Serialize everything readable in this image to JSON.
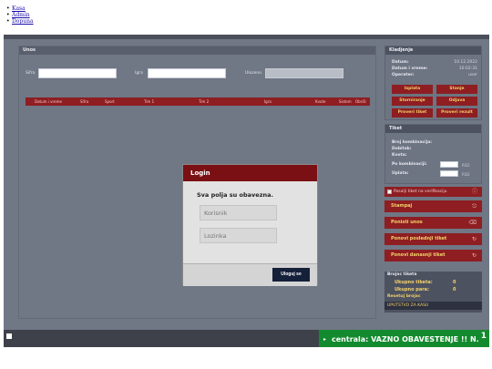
{
  "nav_links": [
    "Kasa",
    "Admin",
    "Dopuna"
  ],
  "unos": {
    "title": "Unos",
    "sifra_label": "Sifra",
    "igra_label": "Igra",
    "ulozeno_label": "Ulozeno",
    "columns": [
      "Datum i vreme",
      "Sifra",
      "Sport",
      "Tim 1",
      "Tim 2",
      "Igra",
      "Kvote",
      "Sistem",
      "Obriši"
    ]
  },
  "kladjenje": {
    "title": "Kladjenje",
    "datum_label": "Datum:",
    "datum_value": "10.12.2022",
    "vreme_label": "Datum i vreme:",
    "vreme_value": "10:02:31",
    "operater_label": "Operater:",
    "operater_value": "user",
    "btn_isplata": "Isplata",
    "btn_stanje": "Stanje",
    "btn_storniranje": "Storniranje",
    "btn_odjava": "Odjava",
    "btn_proveri_tiket": "Proveri tiket",
    "btn_proveri_rezult": "Proveri rezult"
  },
  "tiket": {
    "title": "Tiket",
    "broj_kombinacija": "Broj kombinacija:",
    "dobitak": "Dobitak:",
    "kvota": "Kvota:",
    "po_kombinaciji": "Po kombinaciji:",
    "uplata": "Uplata:",
    "currency": "RSD"
  },
  "verifikacija": "Posalji tiket na verifikaciju",
  "actions": {
    "stampaj": "Stampaj",
    "ponisti_unos": "Ponisti unos",
    "ponovi_poslednji": "Ponovi poslednji tiket",
    "ponovi_danasnji": "Ponovi danasnji tiket"
  },
  "brojac": {
    "title": "Brojac tiketa",
    "ukupno_tiketa_label": "Ukupno tiketa:",
    "ukupno_tiketa_value": "0",
    "ukupno_para_label": "Ukupno para:",
    "ukupno_para_value": "0",
    "resetuj": "Resetuj brojac",
    "uputstvo": "UPUTSTVO ZA KASU"
  },
  "login": {
    "title": "Login",
    "message": "Sva polja su obavezna.",
    "username_placeholder": "Korisnik",
    "password_placeholder": "Lozinka",
    "submit": "Uloguj se"
  },
  "ticker": {
    "text": "centrala: VAZNO OBAVESTENJE !! N.",
    "count": "1"
  },
  "colors": {
    "accent_red": "#8e1e22",
    "modal_header": "#7a1014",
    "ticker_green": "#138a2e",
    "highlight_yellow": "#f3d16a"
  }
}
